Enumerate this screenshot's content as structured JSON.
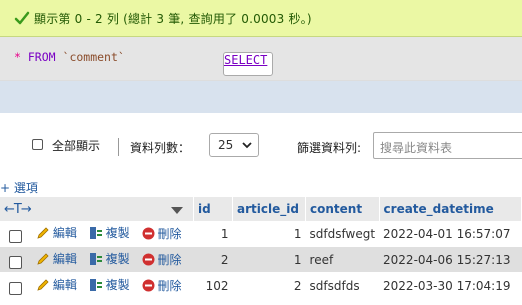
{
  "message": {
    "text": "顯示第 0 - 2 列 (總計 3 筆, 查詢用了 0.0003 秒。)"
  },
  "sql": {
    "select": "SELECT",
    "star": "*",
    "from": "FROM",
    "table": "`comment`"
  },
  "navigation": {
    "show_all_label": "全部顯示",
    "rows_label": "資料列數：",
    "rows_value": "25",
    "filter_label": "篩選資料列:",
    "filter_placeholder": "搜尋此資料表"
  },
  "options_link": "+ 選項",
  "columns": [
    "id",
    "article_id",
    "content",
    "create_datetime"
  ],
  "actions": {
    "edit": "編輯",
    "copy": "複製",
    "delete": "刪除"
  },
  "rows": [
    {
      "id": "1",
      "article_id": "1",
      "content": "sdfdsfwegt",
      "create_datetime": "2022-04-01 16:57:07"
    },
    {
      "id": "2",
      "article_id": "1",
      "content": "reef",
      "create_datetime": "2022-04-06 15:27:13"
    },
    {
      "id": "102",
      "article_id": "2",
      "content": "sdfsdfds",
      "create_datetime": "2022-03-30 17:04:19"
    }
  ],
  "colors": {
    "success_bg": "#ebf8a4",
    "link": "#235a9e",
    "keyword": "#7a00c4"
  }
}
